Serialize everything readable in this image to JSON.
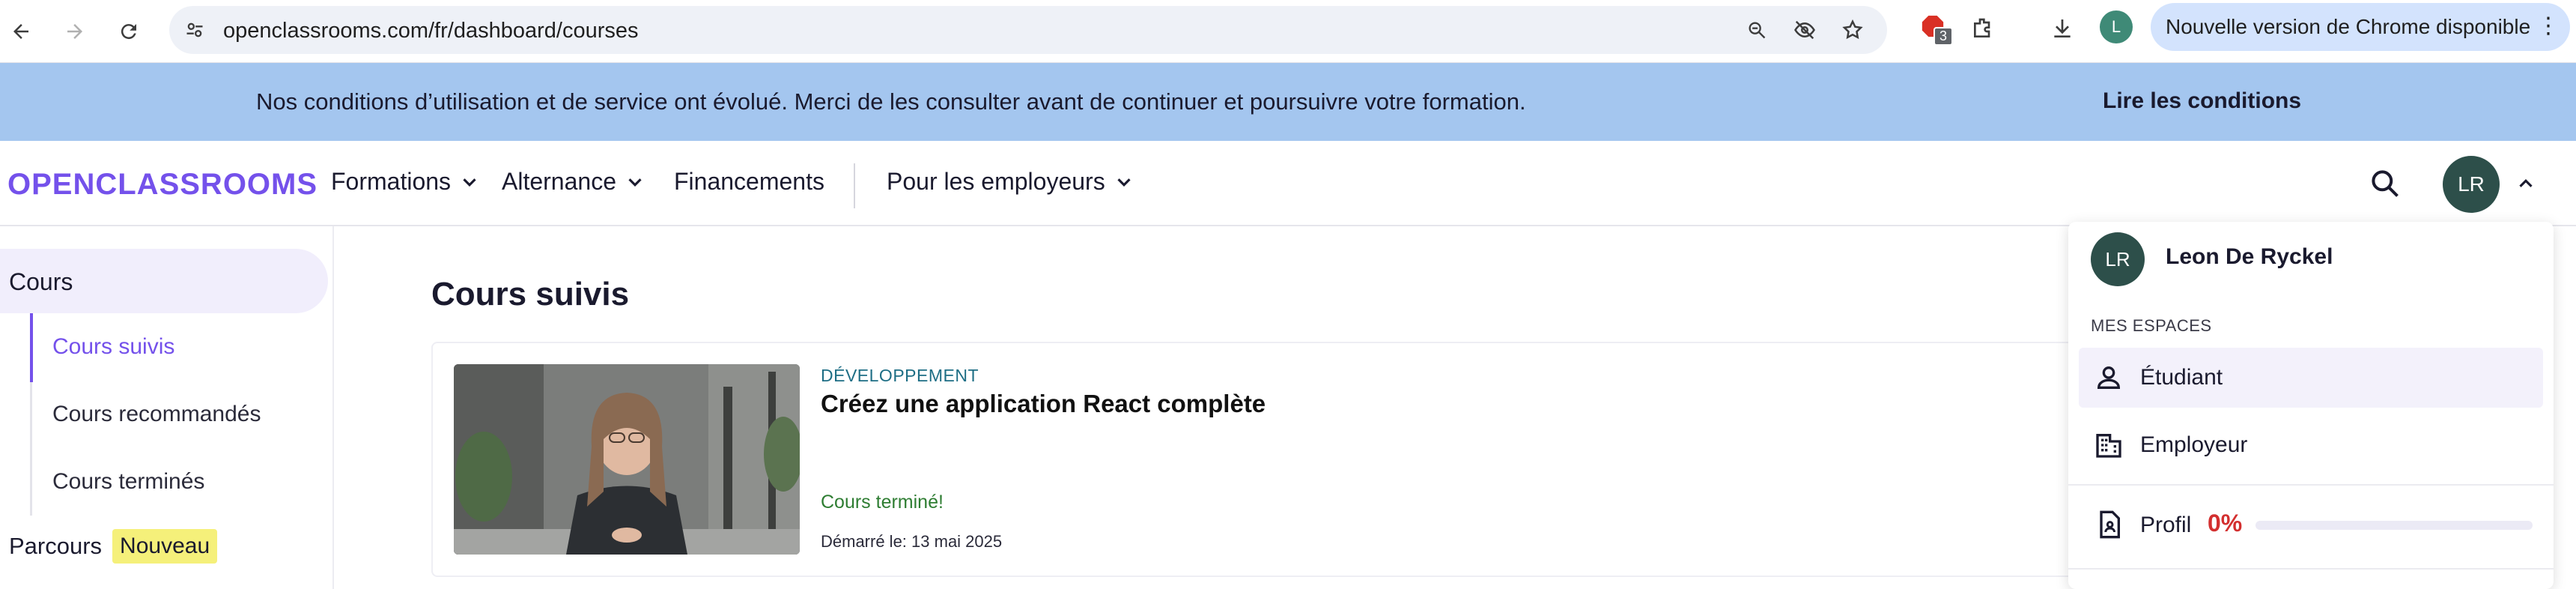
{
  "browser": {
    "url": "openclassrooms.com/fr/dashboard/courses",
    "extension_badge": "3",
    "profile_initial": "L",
    "update_label": "Nouvelle version de Chrome disponible"
  },
  "banner": {
    "text": "Nos conditions d’utilisation et de service ont évolué. Merci de les consulter avant de continuer et poursuivre votre formation.",
    "link": "Lire les conditions"
  },
  "header": {
    "logo": "OPENCLASSROOMS",
    "nav": [
      "Formations",
      "Alternance",
      "Financements",
      "Pour les employeurs"
    ],
    "avatar_initials": "LR"
  },
  "sidebar": {
    "section": "Cours",
    "items": [
      "Cours suivis",
      "Cours recommandés",
      "Cours terminés"
    ],
    "parcours_label": "Parcours",
    "parcours_badge": "Nouveau"
  },
  "main": {
    "title": "Cours suivis",
    "course": {
      "category": "DÉVELOPPEMENT",
      "title": "Créez une application React complète",
      "status": "Cours terminé!",
      "started": "Démarré le: 13 mai 2025"
    }
  },
  "dropdown": {
    "avatar_initials": "LR",
    "name": "Leon De Ryckel",
    "section_label": "MES ESPACES",
    "items": [
      "Étudiant",
      "Employeur"
    ],
    "profile_label": "Profil",
    "profile_pct": "0%",
    "profile_progress": 0
  },
  "colors": {
    "brand": "#7451eb",
    "banner": "#a4c6ef",
    "success": "#2e7d32",
    "danger": "#d32f2f",
    "category": "#1e6e85"
  }
}
